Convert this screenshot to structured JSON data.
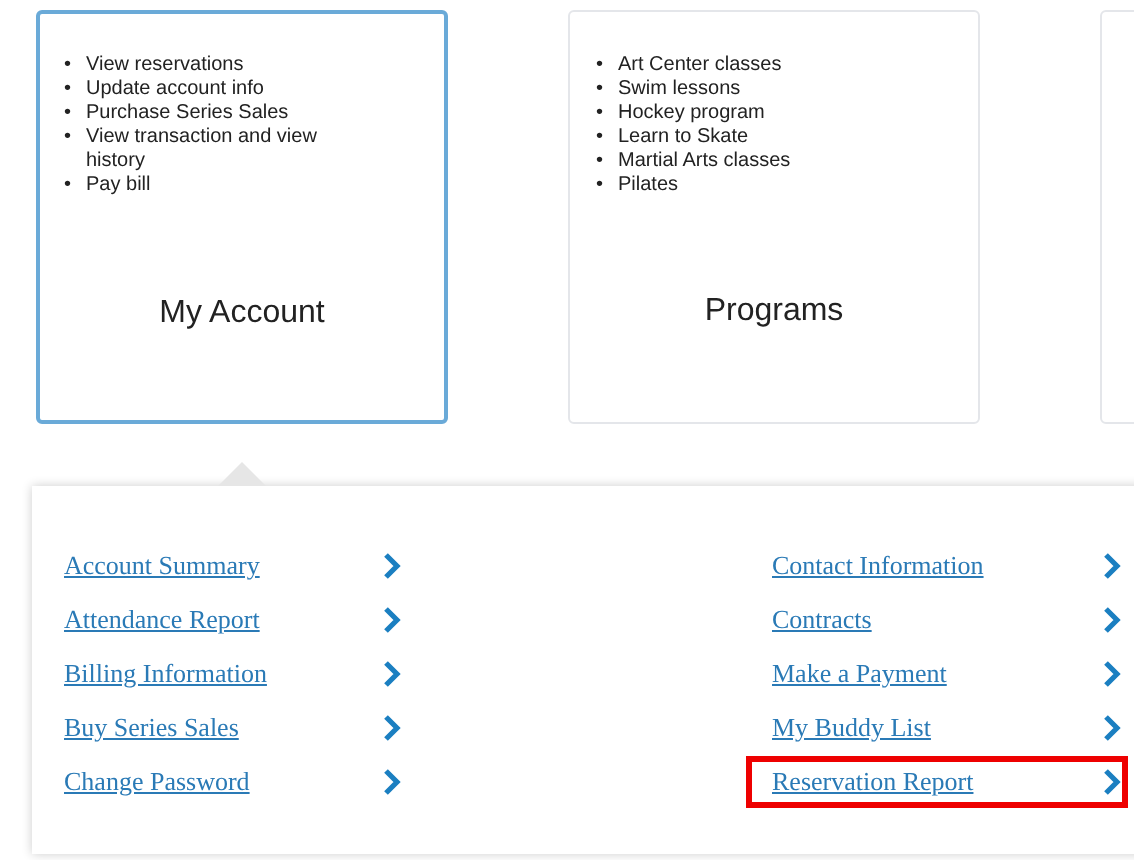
{
  "cards": [
    {
      "title": "My Account",
      "selected": true,
      "items": [
        {
          "bullet": "•",
          "text": "View reservations"
        },
        {
          "bullet": "•",
          "text": "Update account info"
        },
        {
          "bullet": "•",
          "text": "Purchase Series Sales"
        },
        {
          "bullet": "•",
          "text": "View transaction and view history"
        },
        {
          "bullet": "•",
          "text": "Pay bill"
        }
      ]
    },
    {
      "title": "Programs",
      "selected": false,
      "items": [
        {
          "bullet": "•",
          "text": "Art Center classes"
        },
        {
          "bullet": "•",
          "text": "Swim lessons"
        },
        {
          "bullet": "•",
          "text": "Hockey program"
        },
        {
          "bullet": "•",
          "text": "Learn to Skate"
        },
        {
          "bullet": "•",
          "text": "Martial Arts classes"
        },
        {
          "bullet": "•",
          "text": "Pilates"
        }
      ]
    }
  ],
  "menu": {
    "left": [
      {
        "label": "Account Summary",
        "highlighted": false
      },
      {
        "label": "Attendance Report",
        "highlighted": false
      },
      {
        "label": "Billing Information",
        "highlighted": false
      },
      {
        "label": "Buy Series Sales",
        "highlighted": false
      },
      {
        "label": "Change Password",
        "highlighted": false
      }
    ],
    "right": [
      {
        "label": "Contact Information",
        "highlighted": false
      },
      {
        "label": "Contracts",
        "highlighted": false
      },
      {
        "label": "Make a Payment",
        "highlighted": false
      },
      {
        "label": "My Buddy List",
        "highlighted": false
      },
      {
        "label": "Reservation Report",
        "highlighted": true
      }
    ]
  }
}
